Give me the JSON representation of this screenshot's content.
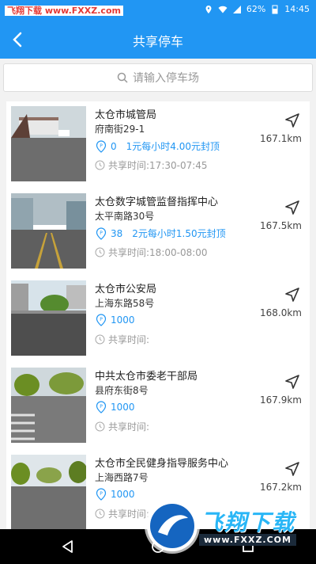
{
  "status_bar": {
    "watermark_text": "飞翔下载 www.FXXZ.com",
    "battery": "62%",
    "time": "14:45"
  },
  "header": {
    "title": "共享停车"
  },
  "search": {
    "placeholder": "请输入停车场"
  },
  "parking_list": [
    {
      "name": "太仓市城管局",
      "address": "府南街29-1",
      "spaces": "0",
      "price_prefix": "1元每小时",
      "price_cap": "4.00",
      "price_suffix": "元封顶",
      "share_time_label": "共享时间:",
      "share_time": "17:30-07:45",
      "distance": "167.1km"
    },
    {
      "name": "太仓数字城管监督指挥中心",
      "address": "太平南路30号",
      "spaces": "38",
      "price_prefix": "2元每小时",
      "price_cap": "1.50",
      "price_suffix": "元封顶",
      "share_time_label": "共享时间:",
      "share_time": "18:00-08:00",
      "distance": "167.5km"
    },
    {
      "name": "太仓市公安局",
      "address": "上海东路58号",
      "spaces": "1000",
      "price_prefix": "",
      "price_cap": "",
      "price_suffix": "",
      "share_time_label": "共享时间:",
      "share_time": "",
      "distance": "168.0km"
    },
    {
      "name": "中共太仓市委老干部局",
      "address": "县府东街8号",
      "spaces": "1000",
      "price_prefix": "",
      "price_cap": "",
      "price_suffix": "",
      "share_time_label": "共享时间:",
      "share_time": "",
      "distance": "167.9km"
    },
    {
      "name": "太仓市全民健身指导服务中心",
      "address": "上海西路7号",
      "spaces": "1000",
      "price_prefix": "",
      "price_cap": "",
      "price_suffix": "",
      "share_time_label": "共享时间:",
      "share_time": "",
      "distance": "167.2km"
    }
  ],
  "bottom_watermark": {
    "text": "飞翔下载",
    "url": "www.FXXZ.COM"
  },
  "colors": {
    "primary": "#2196f3",
    "accent_text": "#2196f3"
  }
}
